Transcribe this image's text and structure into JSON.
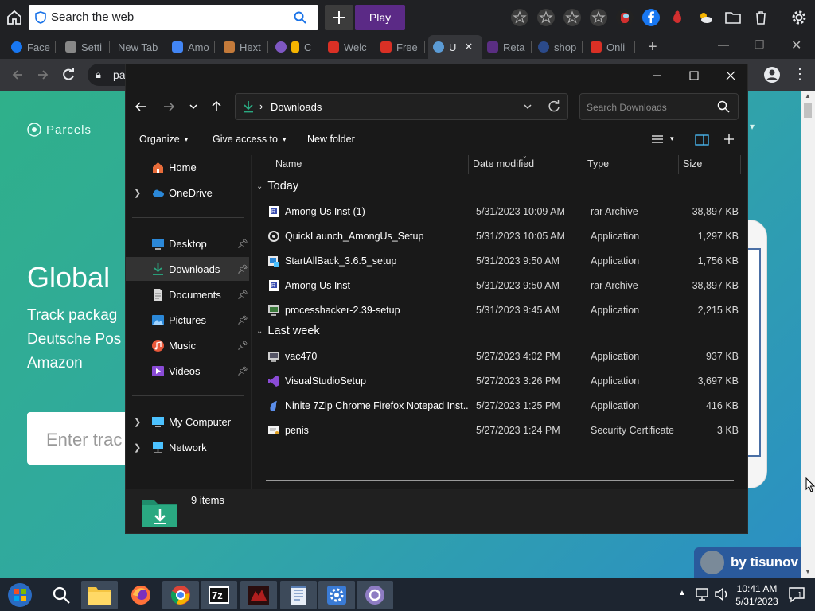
{
  "browser": {
    "search_placeholder": "Search the web",
    "play_label": "Play",
    "address_text": "pa",
    "tabs": [
      {
        "label": "Face",
        "color": "#1877f2"
      },
      {
        "label": "Setti",
        "color": "#888888"
      },
      {
        "label": "New Tab",
        "color": ""
      },
      {
        "label": "Amo",
        "color": "#4285f4"
      },
      {
        "label": "Hext",
        "color": "#c47a3a"
      },
      {
        "label": "C",
        "color": "#7e57c2"
      },
      {
        "label": "Welc",
        "color": "#d93025"
      },
      {
        "label": "Free",
        "color": "#d93025"
      },
      {
        "label": "U",
        "color": "#5b9bd5"
      },
      {
        "label": "Reta",
        "color": "#5a2e82"
      },
      {
        "label": "shop",
        "color": "#2b4a8a"
      },
      {
        "label": "Onli",
        "color": "#d93025"
      }
    ]
  },
  "webpage": {
    "logo": "Parcels",
    "heading": "Global",
    "subtitle_lines": [
      "Track packag",
      "Deutsche Pos",
      "Amazon"
    ],
    "track_placeholder": "Enter trac",
    "promo": "by tisunov"
  },
  "explorer": {
    "breadcrumb": "Downloads",
    "search_placeholder": "Search Downloads",
    "commands": {
      "organize": "Organize",
      "give_access": "Give access to",
      "new_folder": "New folder"
    },
    "nav": [
      {
        "label": "Home",
        "icon": "home-icon",
        "pinned": false,
        "expand": false
      },
      {
        "label": "OneDrive",
        "icon": "cloud-icon",
        "pinned": false,
        "expand": true
      },
      {
        "label": "Desktop",
        "icon": "desktop-icon",
        "pinned": true,
        "expand": false
      },
      {
        "label": "Downloads",
        "icon": "download-icon",
        "pinned": true,
        "expand": false,
        "selected": true
      },
      {
        "label": "Documents",
        "icon": "document-icon",
        "pinned": true,
        "expand": false
      },
      {
        "label": "Pictures",
        "icon": "picture-icon",
        "pinned": true,
        "expand": false
      },
      {
        "label": "Music",
        "icon": "music-icon",
        "pinned": true,
        "expand": false
      },
      {
        "label": "Videos",
        "icon": "video-icon",
        "pinned": true,
        "expand": false
      },
      {
        "label": "My Computer",
        "icon": "computer-icon",
        "pinned": false,
        "expand": true
      },
      {
        "label": "Network",
        "icon": "network-icon",
        "pinned": false,
        "expand": true
      }
    ],
    "columns": {
      "name": "Name",
      "date": "Date modified",
      "type": "Type",
      "size": "Size"
    },
    "groups": [
      {
        "label": "Today",
        "files": [
          {
            "name": "Among Us Inst (1)",
            "date": "5/31/2023 10:09 AM",
            "type": "rar Archive",
            "size": "38,897 KB",
            "icon": "archive-icon"
          },
          {
            "name": "QuickLaunch_AmongUs_Setup",
            "date": "5/31/2023 10:05 AM",
            "type": "Application",
            "size": "1,297 KB",
            "icon": "app-icon"
          },
          {
            "name": "StartAllBack_3.6.5_setup",
            "date": "5/31/2023 9:50 AM",
            "type": "Application",
            "size": "1,756 KB",
            "icon": "installer-icon"
          },
          {
            "name": "Among Us Inst",
            "date": "5/31/2023 9:50 AM",
            "type": "rar Archive",
            "size": "38,897 KB",
            "icon": "archive-icon"
          },
          {
            "name": "processhacker-2.39-setup",
            "date": "5/31/2023 9:45 AM",
            "type": "Application",
            "size": "2,215 KB",
            "icon": "installer-icon"
          }
        ]
      },
      {
        "label": "Last week",
        "files": [
          {
            "name": "vac470",
            "date": "5/27/2023 4:02 PM",
            "type": "Application",
            "size": "937 KB",
            "icon": "installer-icon"
          },
          {
            "name": "VisualStudioSetup",
            "date": "5/27/2023 3:26 PM",
            "type": "Application",
            "size": "3,697 KB",
            "icon": "visual-studio-icon"
          },
          {
            "name": "Ninite 7Zip Chrome Firefox Notepad Inst...",
            "date": "5/27/2023 1:25 PM",
            "type": "Application",
            "size": "416 KB",
            "icon": "ninite-icon"
          },
          {
            "name": "penis",
            "date": "5/27/2023 1:24 PM",
            "type": "Security Certificate",
            "size": "3 KB",
            "icon": "certificate-icon"
          }
        ]
      }
    ],
    "item_count": "9 items"
  },
  "taskbar": {
    "apps": [
      "start-orb-icon",
      "search-icon",
      "file-explorer-icon",
      "firefox-icon",
      "chrome-icon",
      "7zip-icon",
      "game-app-icon",
      "notepad-icon",
      "settings-app-icon",
      "browser-app-icon"
    ],
    "time": "10:41 AM",
    "date": "5/31/2023",
    "notification_count": "1"
  },
  "colors": {
    "accent": "#4cc2ff",
    "folder": "#2aa981",
    "play": "#5b2a86"
  }
}
